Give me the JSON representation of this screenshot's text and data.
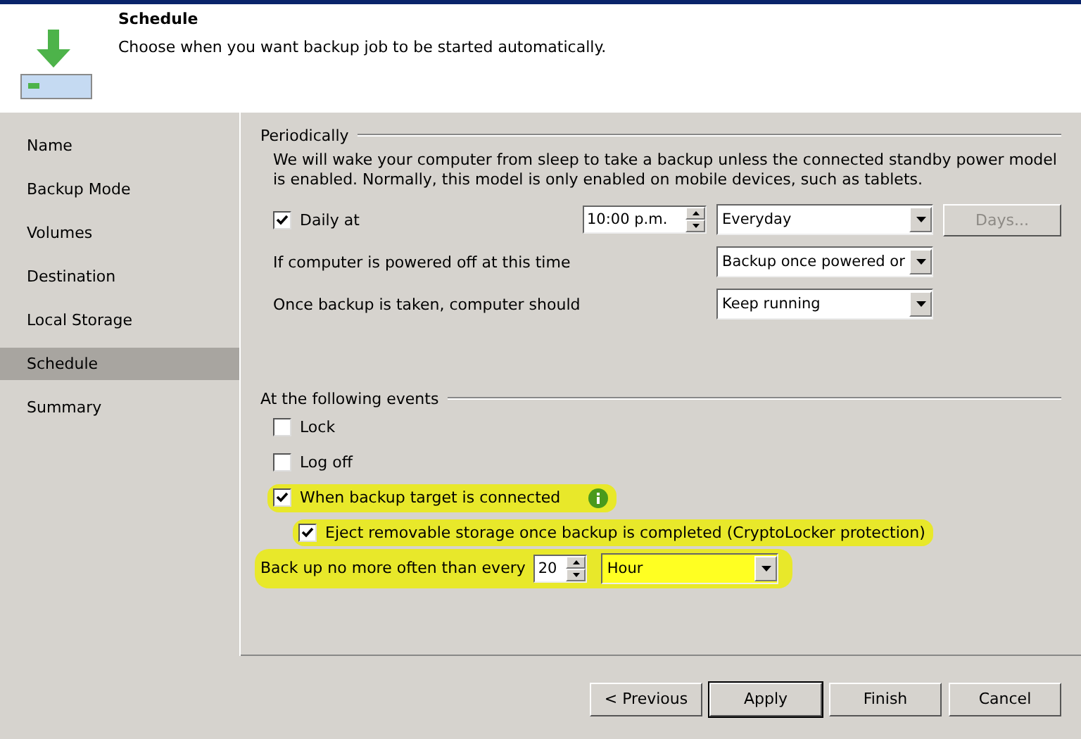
{
  "header": {
    "title": "Schedule",
    "subtitle": "Choose when you want backup job to be started automatically."
  },
  "sidebar": {
    "items": [
      {
        "label": "Name",
        "selected": false
      },
      {
        "label": "Backup Mode",
        "selected": false
      },
      {
        "label": "Volumes",
        "selected": false
      },
      {
        "label": "Destination",
        "selected": false
      },
      {
        "label": "Local Storage",
        "selected": false
      },
      {
        "label": "Schedule",
        "selected": true
      },
      {
        "label": "Summary",
        "selected": false
      }
    ]
  },
  "periodically": {
    "title": "Periodically",
    "description": "We will wake your computer from sleep to take a backup unless the connected standby power model is enabled. Normally, this model is only enabled on mobile devices, such as tablets.",
    "daily": {
      "label": "Daily at",
      "checked": true,
      "time": "10:00 p.m.",
      "frequency": "Everyday",
      "days_button": {
        "label": "Days...",
        "disabled": true
      }
    },
    "powered_off": {
      "label": "If computer is powered off at this time",
      "value": "Backup once powered or"
    },
    "after_backup": {
      "label": "Once backup is taken, computer should",
      "value": "Keep running"
    }
  },
  "events": {
    "title": "At the following events",
    "items": [
      {
        "label": "Lock",
        "checked": false,
        "highlighted": false,
        "info": false
      },
      {
        "label": "Log off",
        "checked": false,
        "highlighted": false,
        "info": false
      },
      {
        "label": "When backup target is connected",
        "checked": true,
        "highlighted": true,
        "info": true,
        "children": [
          {
            "label": "Eject removable storage once backup is completed (CryptoLocker protection)",
            "checked": true,
            "highlighted": true,
            "info": false
          }
        ]
      }
    ],
    "limit": {
      "label": "Back up no more often than every",
      "value": "20",
      "unit": "Hour",
      "highlighted": true
    }
  },
  "buttons": [
    {
      "label": "< Previous",
      "default": false
    },
    {
      "label": "Apply",
      "default": true
    },
    {
      "label": "Finish",
      "default": false
    },
    {
      "label": "Cancel",
      "default": false
    }
  ]
}
